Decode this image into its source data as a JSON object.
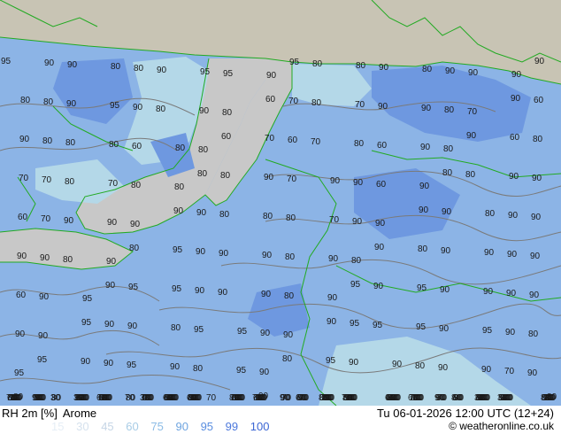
{
  "header": {
    "variable": "RH 2m [%]",
    "model": "Arome",
    "datetime": "Tu 06-01-2026 12:00 UTC (12+24)"
  },
  "legend": {
    "values": [
      "15",
      "30",
      "45",
      "60",
      "75",
      "90",
      "95",
      "99",
      "100"
    ],
    "colors": [
      "#e6eef6",
      "#d6e2ee",
      "#c6d6e6",
      "#a8cce6",
      "#8cbce6",
      "#6ea4e0",
      "#5a8ee0",
      "#4c78dc",
      "#3c66d4"
    ]
  },
  "credit": "© weatheronline.co.uk",
  "map": {
    "colors": {
      "land_outside": "#c8c4b4",
      "sea": "#c8c8c8",
      "rh_base": "#8cb4e6",
      "rh_high": "#6e98e0",
      "rh_low": "#b4d8e8",
      "coast": "#22aa22",
      "contour": "#7a7a7a"
    },
    "labels": [
      "95",
      "90",
      "90",
      "80",
      "80",
      "90",
      "95",
      "95",
      "90",
      "95",
      "80",
      "80",
      "90",
      "80",
      "90",
      "90",
      "90",
      "90",
      "80",
      "80",
      "90",
      "95",
      "90",
      "80",
      "90",
      "80",
      "60",
      "70",
      "80",
      "70",
      "90",
      "90",
      "80",
      "70",
      "90",
      "60",
      "90",
      "80",
      "80",
      "80",
      "60",
      "80",
      "80",
      "60",
      "70",
      "60",
      "70",
      "80",
      "60",
      "90",
      "80",
      "90",
      "60",
      "80",
      "70",
      "70",
      "80",
      "70",
      "80",
      "80",
      "80",
      "80",
      "90",
      "70",
      "90",
      "90",
      "60",
      "90",
      "80",
      "80",
      "90",
      "90",
      "60",
      "70",
      "90",
      "90",
      "90",
      "90",
      "90",
      "80",
      "80",
      "80",
      "70",
      "90",
      "90",
      "90",
      "90",
      "80",
      "90",
      "90",
      "90",
      "90",
      "80",
      "90",
      "80",
      "95",
      "90",
      "90",
      "90",
      "80",
      "90",
      "80",
      "90",
      "80",
      "90",
      "90",
      "90",
      "90",
      "60",
      "90",
      "95",
      "90",
      "95",
      "95",
      "90",
      "90",
      "90",
      "80",
      "90",
      "95",
      "90",
      "95",
      "90",
      "90",
      "90",
      "90",
      "90",
      "90",
      "95",
      "90",
      "90",
      "80",
      "95",
      "95",
      "90",
      "90",
      "90",
      "95",
      "95",
      "95",
      "90",
      "95",
      "90",
      "80",
      "95",
      "95",
      "90",
      "90",
      "95",
      "90",
      "80",
      "95",
      "90",
      "80",
      "95",
      "90",
      "90",
      "80",
      "90",
      "90",
      "70",
      "90",
      "80",
      "80",
      "90",
      "90",
      "80",
      "80",
      "90",
      "80",
      "90",
      "70",
      "90",
      "90",
      "90",
      "70",
      "70",
      "80",
      "70",
      "80",
      "90",
      "90",
      "70",
      "80",
      "70",
      "90",
      "90",
      "80",
      "60",
      "90",
      "80",
      "90",
      "80",
      "80",
      "60",
      "70",
      "80",
      "70",
      "80",
      "90",
      "90",
      "70",
      "80",
      "90",
      "80",
      "90",
      "80",
      "90",
      "80",
      "70",
      "60",
      "70",
      "90",
      "80",
      "70",
      "80",
      "80",
      "80",
      "60",
      "80",
      "70",
      "60",
      "90",
      "70",
      "90",
      "70",
      "80",
      "90",
      "80",
      "70",
      "90",
      "80",
      "90",
      "80",
      "90",
      "90",
      "80",
      "90",
      "90",
      "90",
      "80",
      "60",
      "90",
      "90",
      "70",
      "90",
      "80",
      "90",
      "90",
      "90",
      "60",
      "70",
      "70",
      "90",
      "80",
      "60",
      "60",
      "60",
      "80",
      "80",
      "70",
      "60",
      "70",
      "60",
      "80",
      "70",
      "80",
      "80",
      "90",
      "90",
      "80",
      "80",
      "90",
      "70",
      "70",
      "60",
      "60",
      "70",
      "60",
      "80",
      "60",
      "80",
      "60",
      "70",
      "60",
      "60",
      "60",
      "60",
      "60",
      "30",
      "30",
      "60",
      "30",
      "60",
      "70",
      "80",
      "70",
      "60",
      "80",
      "70",
      "60",
      "60",
      "80",
      "30",
      "30",
      "80",
      "70"
    ]
  }
}
